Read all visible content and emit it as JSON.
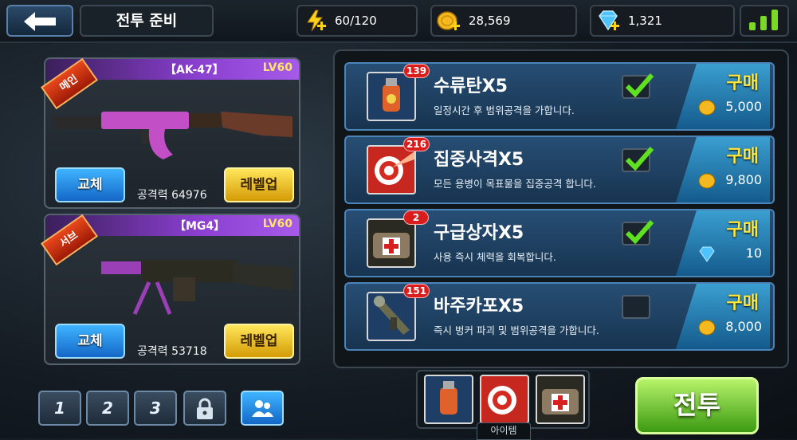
{
  "header": {
    "title": "전투 준비",
    "energy": "60/120",
    "gold": "28,569",
    "gems": "1,321"
  },
  "weapons": [
    {
      "slot_label": "메인",
      "name": "【AK-47】",
      "level": "LV60",
      "swap_label": "교체",
      "power": "공격력 64976",
      "levelup_label": "레벨업"
    },
    {
      "slot_label": "서브",
      "name": "【MG4】",
      "level": "LV60",
      "swap_label": "교체",
      "power": "공격력 53718",
      "levelup_label": "레벨업"
    }
  ],
  "items": [
    {
      "count": "139",
      "name": "수류탄X5",
      "desc": "일정시간 후 범위공격을 가합니다.",
      "checked": true,
      "buy_label": "구매",
      "price": "5,000",
      "currency": "gold"
    },
    {
      "count": "216",
      "name": "집중사격X5",
      "desc": "모든 용병이 목표물을 집중공격 합니다.",
      "checked": true,
      "buy_label": "구매",
      "price": "9,800",
      "currency": "gold"
    },
    {
      "count": "2",
      "name": "구급상자X5",
      "desc": "사용 즉시 체력을 회복합니다.",
      "checked": true,
      "buy_label": "구매",
      "price": "10",
      "currency": "gem"
    },
    {
      "count": "151",
      "name": "바주카포X5",
      "desc": "즉시 벙커 파괴 및 범위공격을 가합니다.",
      "checked": false,
      "buy_label": "구매",
      "price": "8,000",
      "currency": "gold"
    }
  ],
  "loadout_slots": [
    "1",
    "2",
    "3"
  ],
  "equipped_label": "아이템",
  "battle_label": "전투",
  "colors": {
    "accent_green": "#7cd826",
    "buy_yellow": "#ffe63a",
    "weapon_header_purple": "#8a3fd0"
  }
}
